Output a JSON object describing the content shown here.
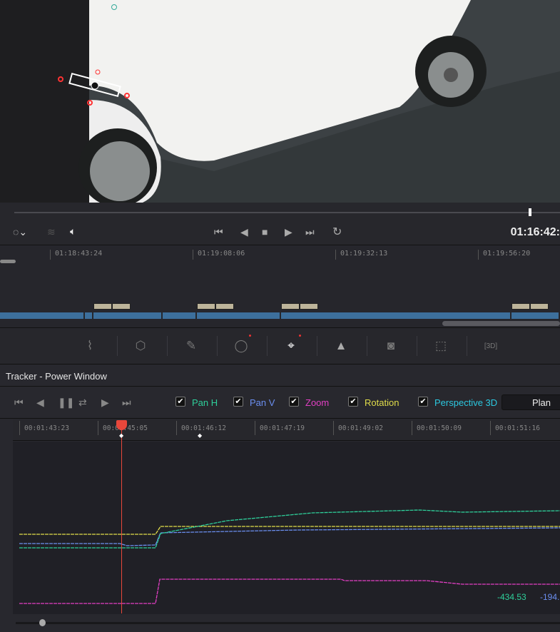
{
  "viewer": {
    "timecode": "01:16:42:"
  },
  "transport": {
    "buttons": [
      "first-frame",
      "reverse-play",
      "stop",
      "play",
      "last-frame",
      "loop"
    ]
  },
  "timeline": {
    "marks": [
      "01:18:43:24",
      "01:19:08:06",
      "01:19:32:13",
      "01:19:56:20"
    ]
  },
  "palette_tools": [
    "curves",
    "warper",
    "qualifier",
    "power-window",
    "tracker",
    "blur",
    "key",
    "sizing",
    "3d"
  ],
  "tracker": {
    "title": "Tracker -  Power Window",
    "checks": [
      {
        "label": "Pan H",
        "checked": true,
        "color": "#2ecf9a"
      },
      {
        "label": "Pan V",
        "checked": true,
        "color": "#6b8ff0"
      },
      {
        "label": "Zoom",
        "checked": true,
        "color": "#e23fc4"
      },
      {
        "label": "Rotation",
        "checked": true,
        "color": "#e0dc4a"
      },
      {
        "label": "Perspective 3D",
        "checked": true,
        "color": "#2cc8e0"
      }
    ],
    "mode": "Plan",
    "ruler": [
      "00:01:43:23",
      "00:01:45:05",
      "00:01:46:12",
      "00:01:47:19",
      "00:01:49:02",
      "00:01:50:09",
      "00:01:51:16"
    ],
    "readouts": [
      {
        "value": "-434.53",
        "color": "#2ecf9a"
      },
      {
        "value": "-194.",
        "color": "#6b8ff0"
      }
    ]
  }
}
